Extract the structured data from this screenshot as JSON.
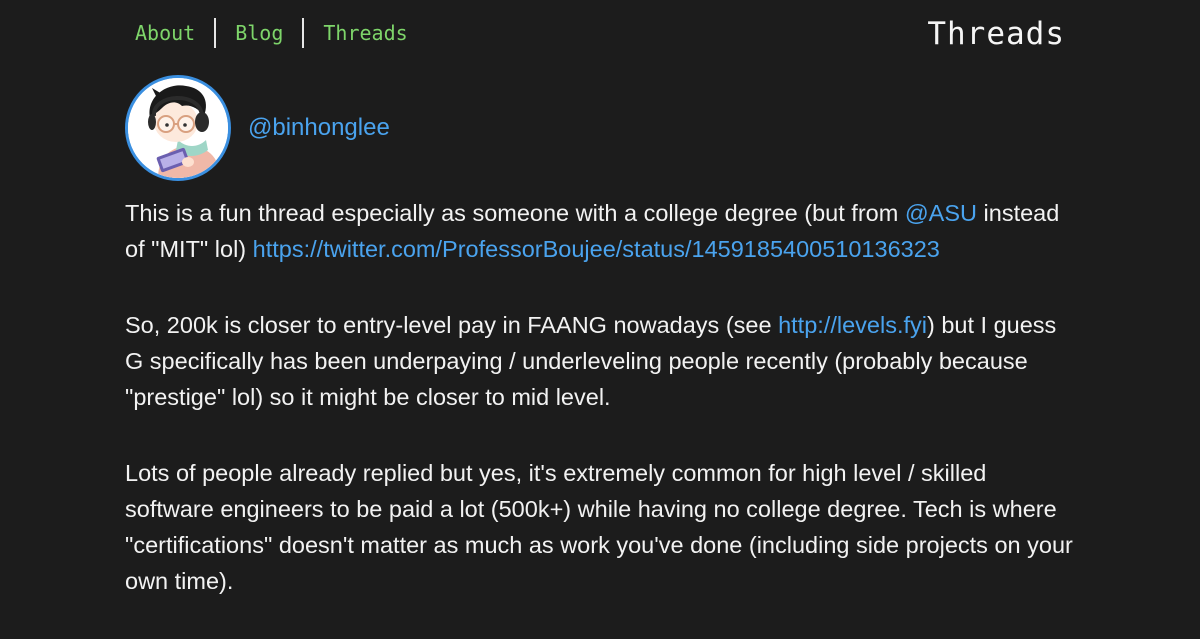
{
  "nav": {
    "about": "About",
    "blog": "Blog",
    "threads": "Threads"
  },
  "page_title": "Threads",
  "profile": {
    "handle": "@binhonglee"
  },
  "colors": {
    "background": "#1c1c1c",
    "nav_link": "#7ed56a",
    "link": "#4aa3ee",
    "avatar_border": "#3a8fe0"
  },
  "thread": {
    "p1": {
      "t1": "This is a fun thread especially as someone with a college degree (but from ",
      "mention": "@ASU",
      "t2": " instead of \"MIT\" lol) ",
      "link": "https://twitter.com/ProfessorBoujee/status/1459185400510136323"
    },
    "p2": {
      "t1": "So, 200k is closer to entry-level pay in FAANG nowadays (see ",
      "link": "http://levels.fyi",
      "t2": ") but I guess G specifically has been underpaying / underleveling people recently (probably because \"prestige\" lol) so it might be closer to mid level."
    },
    "p3": {
      "t1": "Lots of people already replied but yes, it's extremely common for high level / skilled software engineers to be paid a lot (500k+) while having no college degree. Tech is where \"certifications\" doesn't matter as much as work you've done (including side projects on your own time)."
    }
  }
}
